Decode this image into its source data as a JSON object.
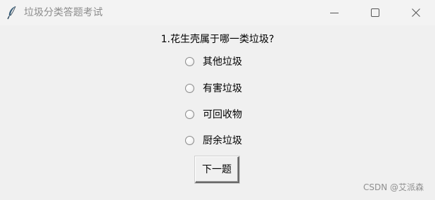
{
  "window": {
    "title": "垃圾分类答题考试",
    "icon": "feather-icon",
    "controls": [
      "minimize-icon",
      "maximize-icon",
      "close-icon"
    ]
  },
  "quiz": {
    "question": "1.花生壳属于哪一类垃圾?",
    "options": [
      "其他垃圾",
      "有害垃圾",
      "可回收物",
      "厨余垃圾"
    ],
    "next_label": "下一题"
  },
  "watermark": "CSDN @艾派森"
}
